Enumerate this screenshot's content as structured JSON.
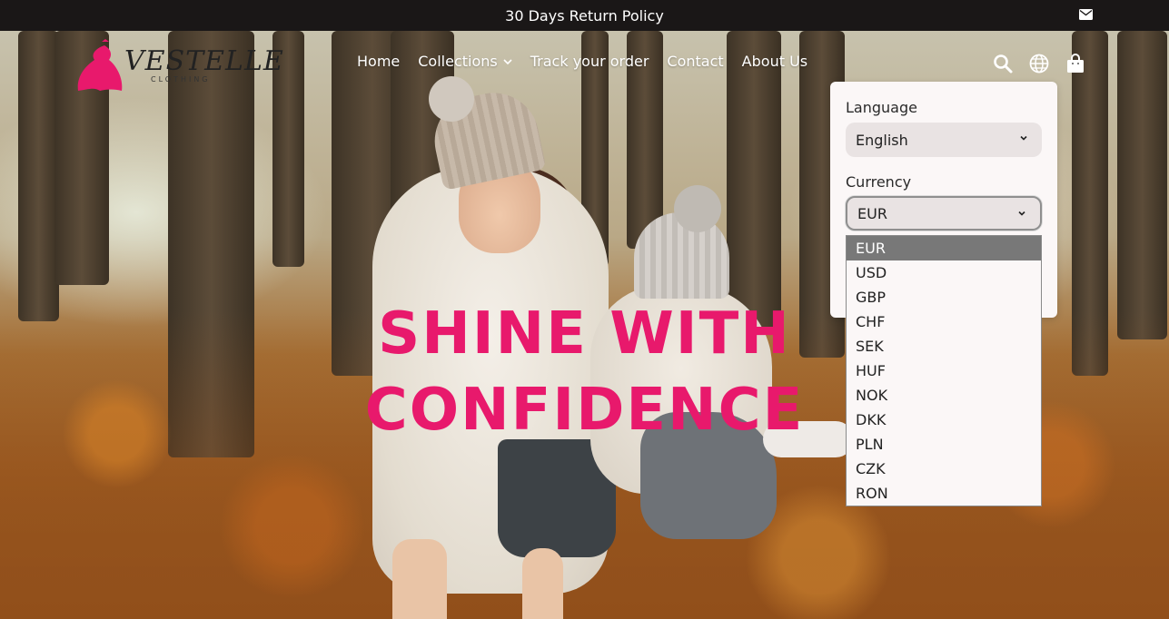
{
  "announcement": {
    "text": "30 Days Return Policy",
    "mail_icon": "mail-icon"
  },
  "brand": {
    "logo_text": "VESTELLE",
    "logo_subtext": "CLOTHING",
    "accent_color": "#e8196c"
  },
  "nav": {
    "items": [
      {
        "label": "Home"
      },
      {
        "label": "Collections",
        "has_dropdown": true
      },
      {
        "label": "Track your order"
      },
      {
        "label": "Contact"
      },
      {
        "label": "About Us"
      }
    ]
  },
  "header_icons": {
    "search": "search-icon",
    "globe": "globe-icon",
    "cart": "shopping-bag-icon"
  },
  "localization": {
    "language_label": "Language",
    "language_value": "English",
    "currency_label": "Currency",
    "currency_value": "EUR",
    "currency_options": [
      "EUR",
      "USD",
      "GBP",
      "CHF",
      "SEK",
      "HUF",
      "NOK",
      "DKK",
      "PLN",
      "CZK",
      "RON"
    ],
    "selected_option": "EUR"
  },
  "hero": {
    "headline_line1": "SHINE WITH",
    "headline_line2": "CONFIDENCE"
  }
}
